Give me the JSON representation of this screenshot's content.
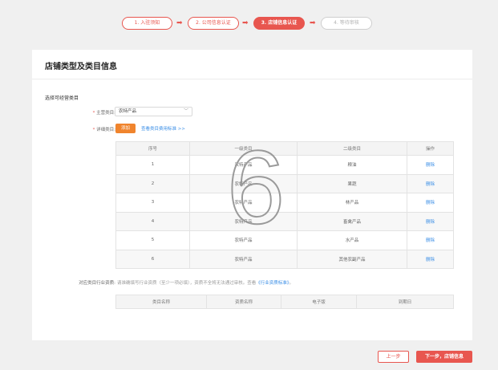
{
  "stepper": {
    "steps": [
      {
        "label": "1. 入驻须知",
        "state": "done"
      },
      {
        "label": "2. 公司信息认证",
        "state": "done"
      },
      {
        "label": "3. 店铺信息认证",
        "state": "active"
      },
      {
        "label": "4. 等待审核",
        "state": "todo"
      }
    ],
    "arrow": "➡"
  },
  "card": {
    "title": "店铺类型及类目信息",
    "section_title": "选择可经营类目",
    "main_category": {
      "label": "主营类目:",
      "value": "农特产品"
    },
    "detail_category": {
      "label": "详细类目:",
      "add_button": "添加",
      "standard_link": "查看类目费用标准 >>"
    },
    "category_table": {
      "headers": [
        "序号",
        "一级类目",
        "二级类目",
        "操作"
      ],
      "rows": [
        {
          "no": "1",
          "level1": "农特产品",
          "level2": "粮油",
          "op": "删除"
        },
        {
          "no": "2",
          "level1": "农特产品",
          "level2": "果蔬",
          "op": "删除"
        },
        {
          "no": "3",
          "level1": "农特产品",
          "level2": "林产品",
          "op": "删除"
        },
        {
          "no": "4",
          "level1": "农特产品",
          "level2": "畜禽产品",
          "op": "删除"
        },
        {
          "no": "5",
          "level1": "农特产品",
          "level2": "水产品",
          "op": "删除"
        },
        {
          "no": "6",
          "level1": "农特产品",
          "level2": "其他农副产品",
          "op": "删除"
        }
      ]
    },
    "cert": {
      "label": "对应类目行业资质:",
      "note": "请准确填写行业资质（至少一项必填），资质不全将无法通过审核。查看",
      "link": "《行业资质标准》",
      "note_end": "。",
      "table_headers": [
        "类目名称",
        "资质名称",
        "电子版",
        "到期日"
      ]
    }
  },
  "footer": {
    "prev_label": "上一步",
    "next_label": "下一步，店铺信息"
  },
  "watermark": {
    "text": "6"
  },
  "colors": {
    "accent": "#e8564f",
    "add_button": "#f0842d",
    "link": "#3a8ee6",
    "page_bg": "#f0f0f0"
  }
}
